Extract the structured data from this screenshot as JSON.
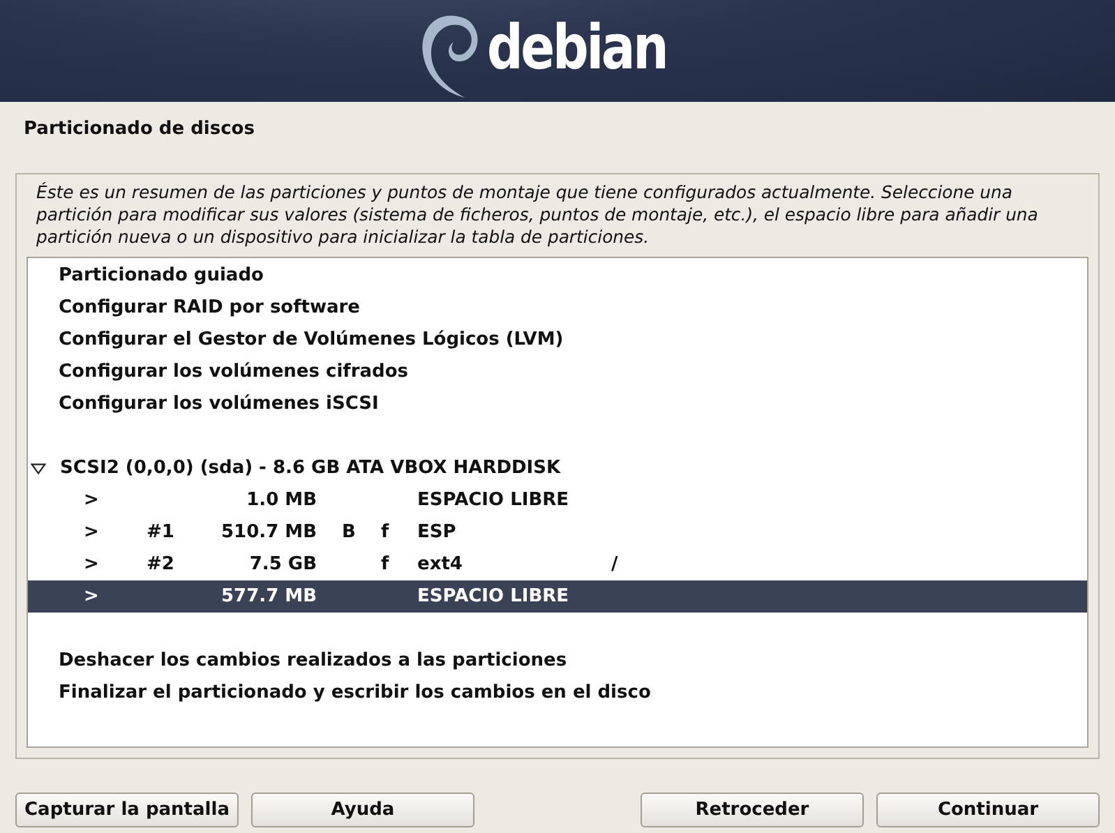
{
  "header": {
    "logo_text": "debian"
  },
  "title": "Particionado de discos",
  "description": "Éste es un resumen de las particiones y puntos de montaje que tiene configurados actualmente. Seleccione una partición para modificar sus valores (sistema de ficheros, puntos de montaje, etc.), el espacio libre para añadir una partición nueva o un dispositivo para inicializar la tabla de particiones.",
  "options": [
    {
      "label": "Particionado guiado",
      "selected": false
    },
    {
      "label": "Configurar RAID por software",
      "selected": false
    },
    {
      "label": "Configurar el Gestor de Volúmenes Lógicos (LVM)",
      "selected": false
    },
    {
      "label": "Configurar los volúmenes cifrados",
      "selected": false
    },
    {
      "label": "Configurar los volúmenes iSCSI",
      "selected": false
    }
  ],
  "disk": {
    "label": "SCSI2 (0,0,0) (sda) - 8.6 GB ATA VBOX HARDDISK",
    "expanded": true,
    "selected": false,
    "partitions": [
      {
        "arrow": ">",
        "size": "1.0 MB",
        "type": "ESPACIO LIBRE",
        "selected": false
      },
      {
        "arrow": ">",
        "number": "#1",
        "size": "510.7 MB",
        "bootable": "B",
        "format": "f",
        "type": "ESP",
        "selected": false
      },
      {
        "arrow": ">",
        "number": "#2",
        "size": "7.5 GB",
        "format": "f",
        "type": "ext4",
        "mount": "/",
        "selected": false
      },
      {
        "arrow": ">",
        "size": "577.7 MB",
        "type": "ESPACIO LIBRE",
        "selected": true
      }
    ]
  },
  "actions": [
    {
      "label": "Deshacer los cambios realizados a las particiones",
      "selected": false
    },
    {
      "label": "Finalizar el particionado y escribir los cambios en el disco",
      "selected": false
    }
  ],
  "buttons_left": [
    "Capturar la pantalla",
    "Ayuda"
  ],
  "buttons_right": [
    "Retroceder",
    "Continuar"
  ]
}
